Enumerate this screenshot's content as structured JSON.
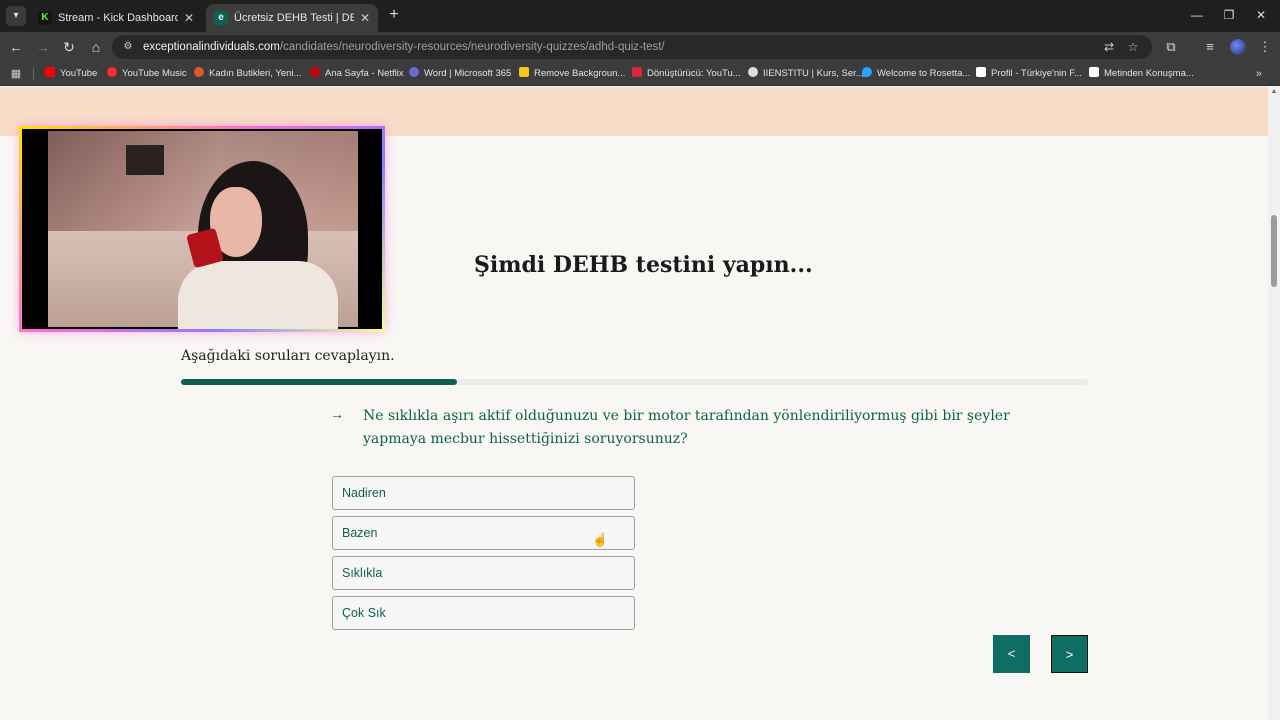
{
  "browser": {
    "tabs": [
      {
        "title": "Stream - Kick Dashboard",
        "favicon": "K",
        "favicon_color": "#53fc18",
        "active": false
      },
      {
        "title": "Ücretsiz DEHB Testi | DEHB'im V",
        "favicon": "e",
        "favicon_color": "#2bb3a6",
        "active": true
      }
    ],
    "close_glyph": "✕",
    "new_tab_glyph": "+",
    "url_host": "exceptionalindividuals.com",
    "url_path": "/candidates/neurodiversity-resources/neurodiversity-quizzes/adhd-quiz-test/",
    "bookmarks": [
      {
        "label": "YouTube",
        "color": "#ff0000"
      },
      {
        "label": "YouTube Music",
        "color": "#ff2a2a"
      },
      {
        "label": "Kadın Butikleri, Yeni...",
        "color": "#e0592a"
      },
      {
        "label": "Ana Sayfa - Netflix",
        "color": "#b20710"
      },
      {
        "label": "Word | Microsoft 365",
        "color": "#6b6bd6"
      },
      {
        "label": "Remove Backgroun...",
        "color": "#f5c518"
      },
      {
        "label": "Dönüştürücü: YouTu...",
        "color": "#d9263b"
      },
      {
        "label": "IIENSTITU | Kurs, Ser...",
        "color": "#dddddd"
      },
      {
        "label": "Welcome to Rosetta...",
        "color": "#2aa5ff"
      },
      {
        "label": "Profil - Türkiye'nin F...",
        "color": "#ffffff"
      },
      {
        "label": "Metinden Konuşma...",
        "color": "#ffffff"
      }
    ]
  },
  "page": {
    "heading": "Şimdi DEHB testini yapın...",
    "intro": "Aşağıdaki soruları cevaplayın.",
    "progress_fraction": 0.304,
    "question_arrow": "→",
    "question": "Ne sıklıkla aşırı aktif olduğunuzu ve bir motor tarafından yönlendiriliyormuş gibi bir şeyler yapmaya mecbur hissettiğinizi soruyorsunuz?",
    "answers": [
      "Nadiren",
      "Bazen",
      "Sıklıkla",
      "Çok Sık"
    ],
    "prev_label": "<",
    "next_label": ">"
  },
  "colors": {
    "accent": "#0f5e52",
    "peach_band": "#f7dcc7",
    "page_bg": "#f8f7f4"
  }
}
